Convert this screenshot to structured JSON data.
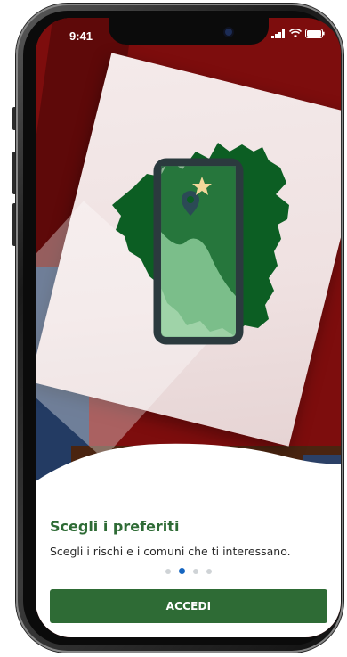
{
  "status_bar": {
    "time": "9:41",
    "icons": [
      "signal-icon",
      "wifi-icon",
      "battery-icon"
    ]
  },
  "illustration": {
    "icons": [
      "region-map-illustration",
      "smartphone-icon",
      "location-pin-icon",
      "star-icon"
    ]
  },
  "onboarding": {
    "title": "Scegli i preferiti",
    "description": "Scegli i rischi e i comuni che ti interessano.",
    "pager": {
      "total_pages": 4,
      "active_index": 1
    },
    "primary_button": "ACCEDI"
  },
  "colors": {
    "brand_green": "#2e6b35",
    "background_red": "#7d0d0d",
    "dot_active": "#1565c0",
    "dot_inactive": "#cfd3d6"
  }
}
